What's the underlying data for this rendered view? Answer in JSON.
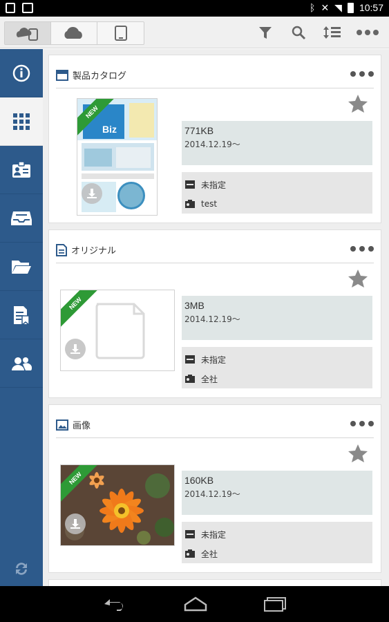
{
  "status_bar": {
    "time": "10:57"
  },
  "toolbar": {
    "segments": [
      "cloud-device-icon",
      "cloud-icon",
      "tablet-icon"
    ],
    "actions": [
      "filter-icon",
      "search-icon",
      "sort-icon",
      "more-icon"
    ]
  },
  "sidebar": {
    "items": [
      "info-icon",
      "grid-icon",
      "id-card-icon",
      "inbox-icon",
      "folder-icon",
      "document-icon",
      "users-icon"
    ],
    "active_index": 1,
    "sync": "sync-icon"
  },
  "cards": [
    {
      "title": "製品カタログ",
      "type_icon": "catalog-icon",
      "badge": "NEW",
      "size": "771KB",
      "date": "2014.12.19～",
      "category": "未指定",
      "scope": "test",
      "thumb_title": "Biz"
    },
    {
      "title": "オリジナル",
      "type_icon": "document-icon",
      "badge": "NEW",
      "size": "3MB",
      "date": "2014.12.19～",
      "category": "未指定",
      "scope": "全社"
    },
    {
      "title": "画像",
      "type_icon": "image-icon",
      "badge": "NEW",
      "size": "160KB",
      "date": "2014.12.19～",
      "category": "未指定",
      "scope": "全社"
    }
  ],
  "colors": {
    "sidebar": "#2d5a8b",
    "badge_green": "#2e9a36",
    "info_bg": "#dfe6e6"
  }
}
